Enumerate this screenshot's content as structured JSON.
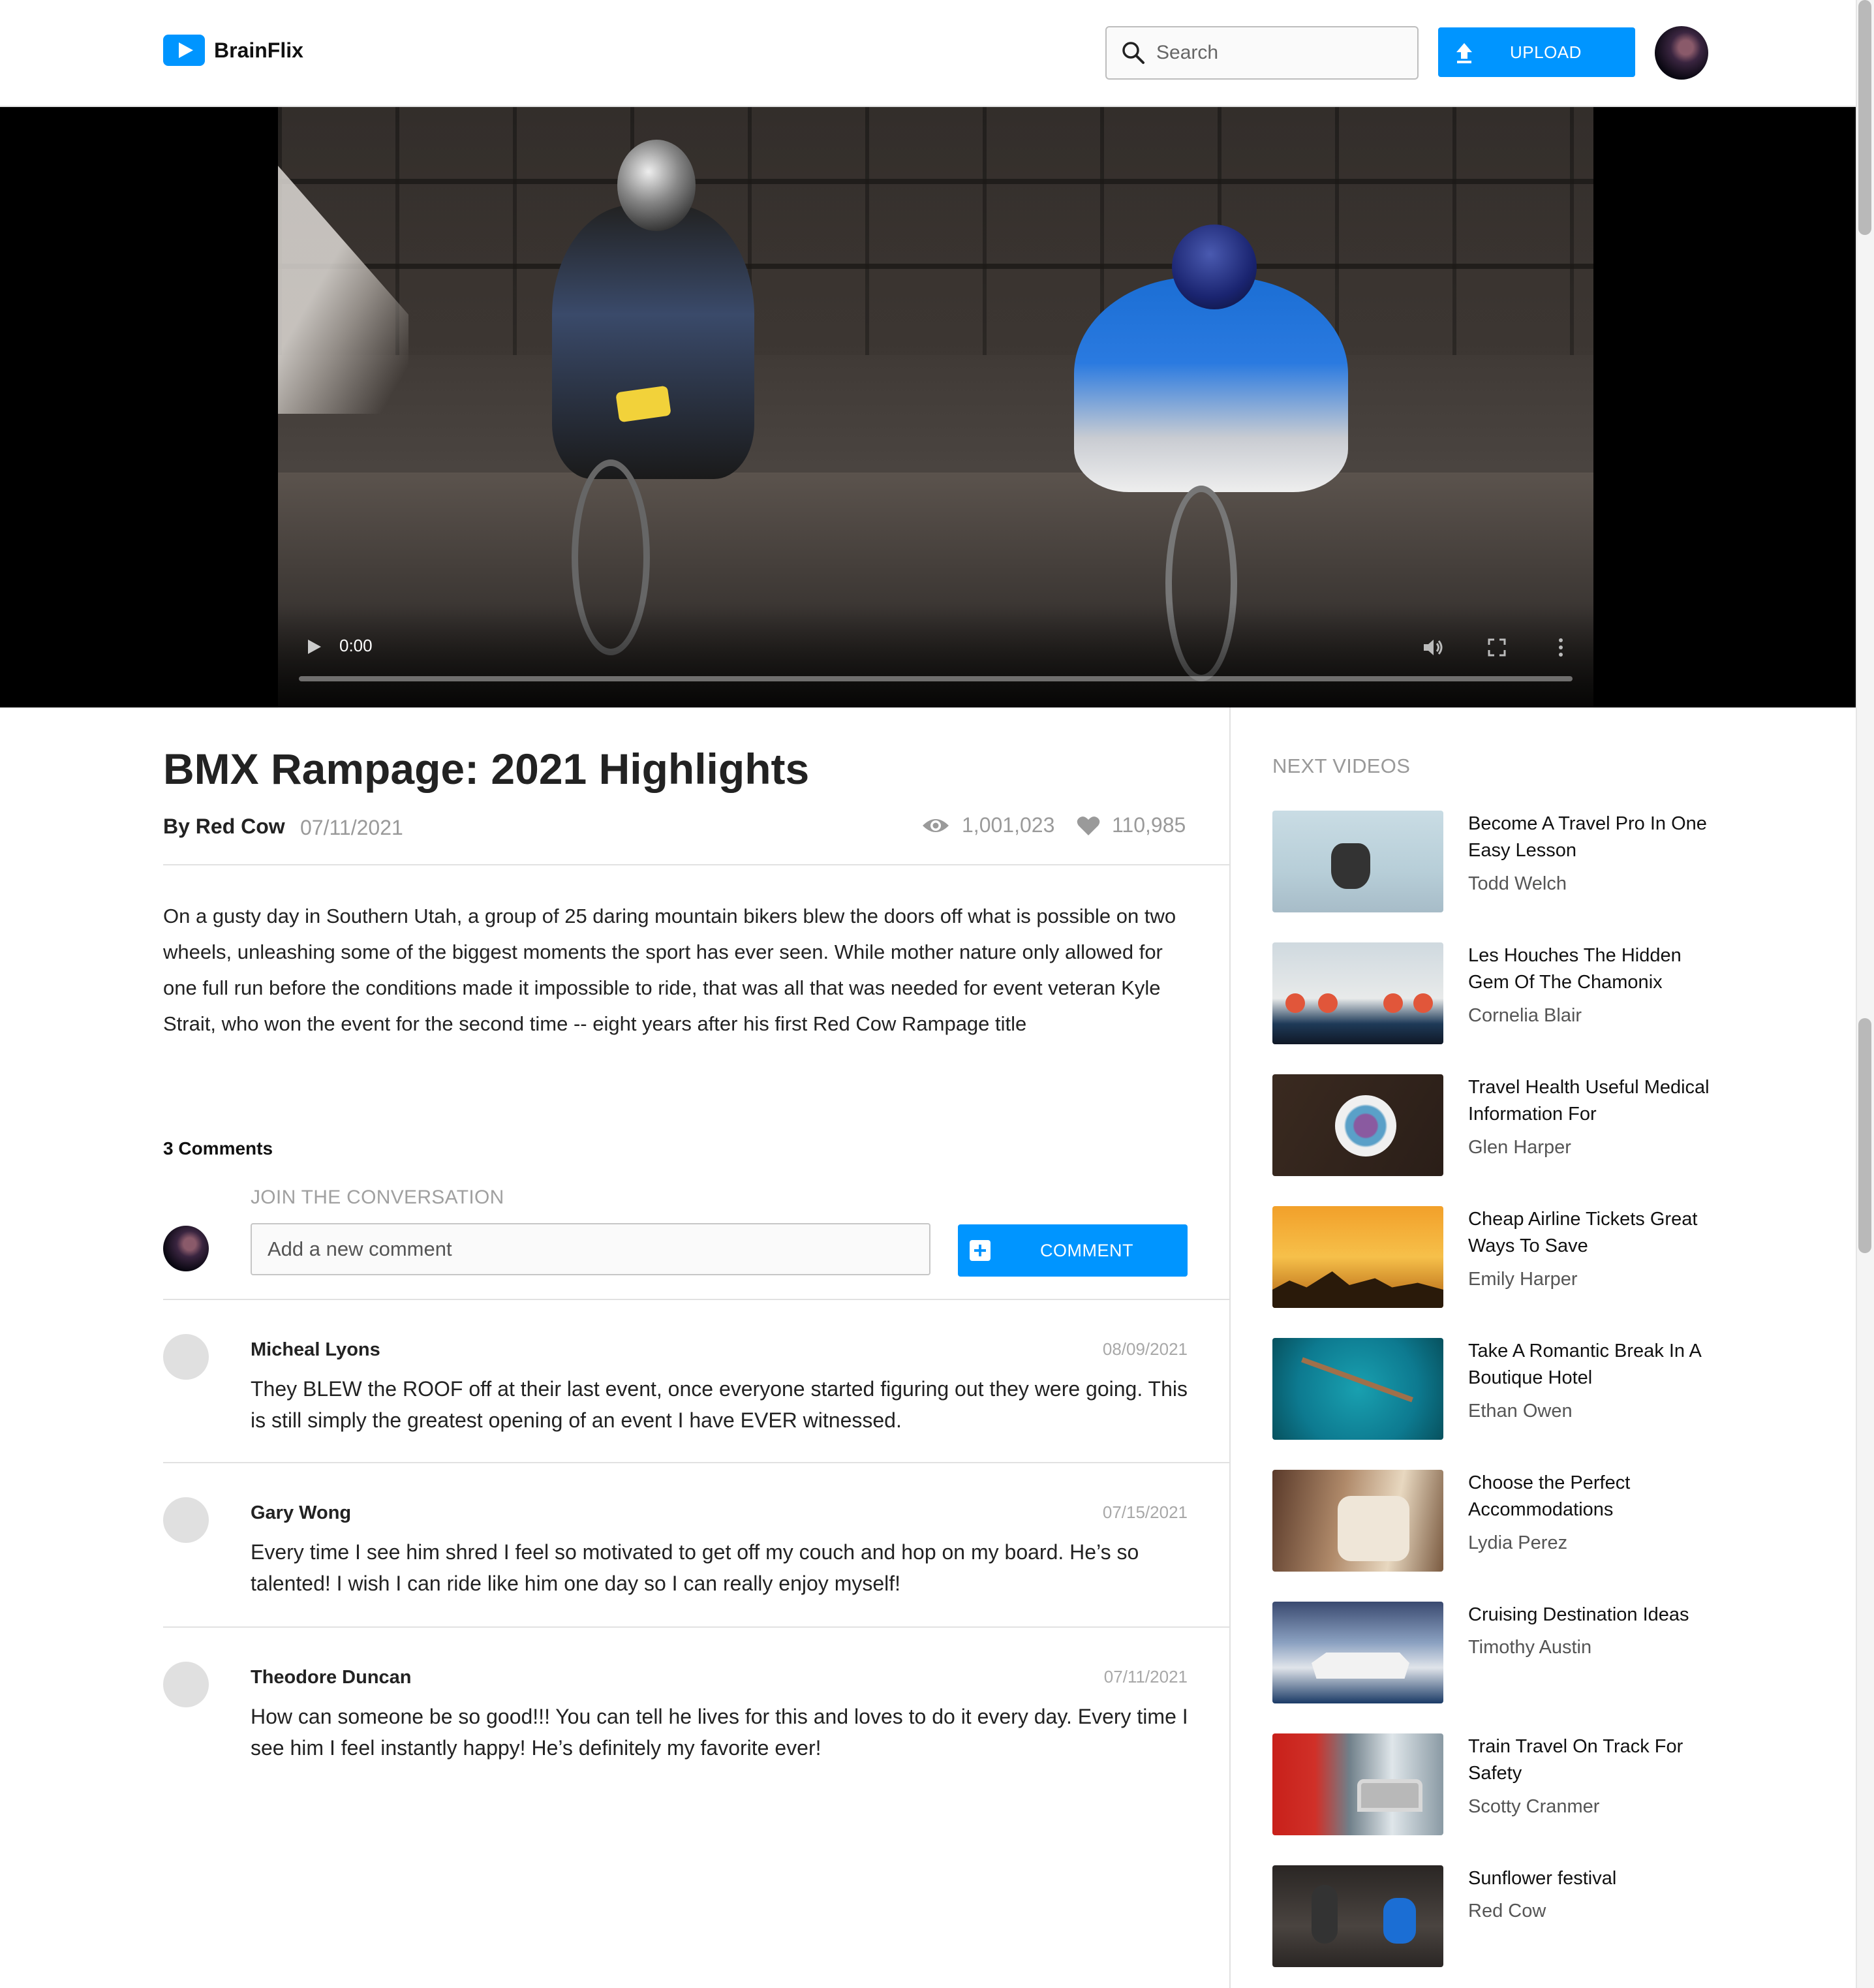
{
  "app": {
    "name": "BrainFlix"
  },
  "header": {
    "search_placeholder": "Search",
    "upload_label": "UPLOAD",
    "search_icon": "search-icon",
    "upload_icon": "upload-icon"
  },
  "player": {
    "current_time": "0:00",
    "controls": [
      "play-icon",
      "volume-icon",
      "fullscreen-icon",
      "more-options-icon"
    ],
    "progress": 0
  },
  "video": {
    "title": "BMX Rampage: 2021 Highlights",
    "channel": "By Red Cow",
    "date": "07/11/2021",
    "views": "1,001,023",
    "likes": "110,985",
    "description": "On a gusty day in Southern Utah, a group of 25 daring mountain bikers blew the doors off what is possible on two wheels, unleashing some of the biggest moments the sport has ever seen. While mother nature only allowed for one full run before the conditions made it impossible to ride, that was all that was needed for event veteran Kyle Strait, who won the event for the second time -- eight years after his first Red Cow Rampage title"
  },
  "comments": {
    "count_label": "3 Comments",
    "join_label": "JOIN THE CONVERSATION",
    "input_placeholder": "Add a new comment",
    "button_label": "COMMENT",
    "items": [
      {
        "name": "Micheal Lyons",
        "date": "08/09/2021",
        "text": "They BLEW the ROOF off at their last event, once everyone started figuring out they were going. This is still simply the greatest opening of an event I have EVER witnessed."
      },
      {
        "name": "Gary Wong",
        "date": "07/15/2021",
        "text": "Every time I see him shred I feel so motivated to get off my couch and hop on my board. He’s so talented! I wish I can ride like him one day so I can really enjoy myself!"
      },
      {
        "name": "Theodore Duncan",
        "date": "07/11/2021",
        "text": "How can someone be so good!!! You can tell he lives for this and loves to do it every day. Every time I see him I feel instantly happy! He’s definitely my favorite ever!"
      }
    ]
  },
  "sidebar": {
    "title": "NEXT VIDEOS",
    "videos": [
      {
        "title": "Become A Travel Pro In One Easy Lesson",
        "author": "Todd Welch"
      },
      {
        "title": "Les Houches The Hidden Gem Of The Chamonix",
        "author": "Cornelia Blair"
      },
      {
        "title": "Travel Health Useful Medical Information For",
        "author": "Glen Harper"
      },
      {
        "title": "Cheap Airline Tickets Great Ways To Save",
        "author": "Emily Harper"
      },
      {
        "title": "Take A Romantic Break In A Boutique Hotel",
        "author": "Ethan Owen"
      },
      {
        "title": "Choose the Perfect Accommodations",
        "author": "Lydia Perez"
      },
      {
        "title": "Cruising Destination Ideas",
        "author": "Timothy Austin"
      },
      {
        "title": "Train Travel On Track For Safety",
        "author": "Scotty Cranmer"
      },
      {
        "title": "Sunflower festival",
        "author": "Red Cow"
      }
    ]
  },
  "colors": {
    "accent": "#0095ff",
    "muted": "#999999",
    "divider": "#e1e1e1"
  }
}
